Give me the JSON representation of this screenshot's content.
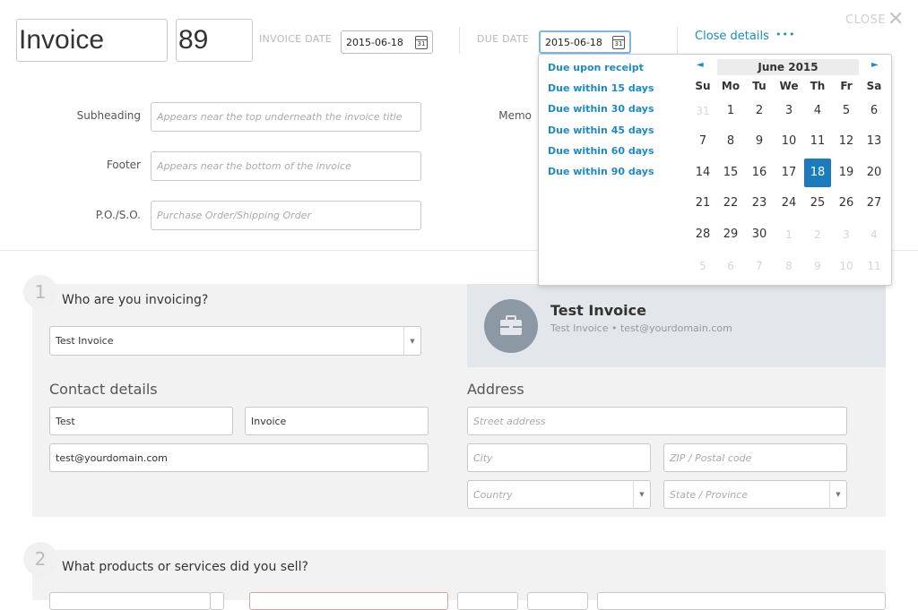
{
  "header": {
    "doc_type": "Invoice",
    "invoice_number": "89",
    "invoice_date_label": "INVOICE DATE",
    "invoice_date": "2015-06-18",
    "due_date_label": "DUE DATE",
    "due_date": "2015-06-18",
    "calendar_icon_text": "31",
    "close_details": "Close details",
    "more": "•••",
    "close": "CLOSE",
    "close_x": "✕"
  },
  "meta_fields": {
    "subheading_label": "Subheading",
    "subheading_placeholder": "Appears near the top underneath the invoice title",
    "footer_label": "Footer",
    "footer_placeholder": "Appears near the bottom of the invoice",
    "poso_label": "P.O./S.O.",
    "poso_placeholder": "Purchase Order/Shipping Order",
    "memo_label": "Memo"
  },
  "due_dropdown": {
    "options": [
      "Due upon receipt",
      "Due within 15 days",
      "Due within 30 days",
      "Due within 45 days",
      "Due within 60 days",
      "Due within 90 days"
    ]
  },
  "calendar": {
    "prev": "◄",
    "next": "►",
    "month": "June 2015",
    "weekdays": [
      "Su",
      "Mo",
      "Tu",
      "We",
      "Th",
      "Fr",
      "Sa"
    ],
    "weeks": [
      [
        "31",
        "1",
        "2",
        "3",
        "4",
        "5",
        "6"
      ],
      [
        "7",
        "8",
        "9",
        "10",
        "11",
        "12",
        "13"
      ],
      [
        "14",
        "15",
        "16",
        "17",
        "18",
        "19",
        "20"
      ],
      [
        "21",
        "22",
        "23",
        "24",
        "25",
        "26",
        "27"
      ],
      [
        "28",
        "29",
        "30",
        "1",
        "2",
        "3",
        "4"
      ],
      [
        "5",
        "6",
        "7",
        "8",
        "9",
        "10",
        "11"
      ]
    ],
    "selected": "18"
  },
  "section1": {
    "number": "1",
    "title": "Who are you invoicing?",
    "client_select": "Test Invoice",
    "contact_title": "Contact details",
    "first_name": "Test",
    "last_name": "Invoice",
    "email": "test@yourdomain.com",
    "address_title": "Address",
    "street_placeholder": "Street address",
    "city_placeholder": "City",
    "zip_placeholder": "ZIP / Postal code",
    "country_placeholder": "Country",
    "state_placeholder": "State / Province",
    "client_card_name": "Test Invoice",
    "client_card_sub": "Test Invoice • test@yourdomain.com"
  },
  "section2": {
    "number": "2",
    "title": "What products or services did you sell?"
  },
  "colors": {
    "accent": "#1a8bc7",
    "selected_day": "#1a7bbd",
    "section_bg": "#f2f2f2",
    "card_bg": "#e3e6ea",
    "avatar_bg": "#8c98a4"
  }
}
